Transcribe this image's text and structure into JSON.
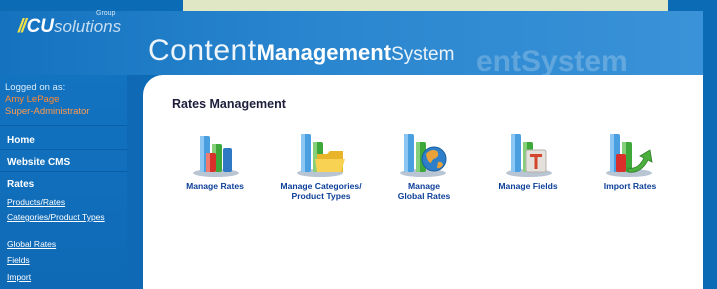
{
  "brand": {
    "logo_prefix": "//",
    "logo_bold": "CU",
    "logo_regular": "solutions",
    "logo_group": "Group",
    "title_part1": "Content",
    "title_part2": "Management",
    "title_part3": "System",
    "title_ghost": "entSystem"
  },
  "sidebar": {
    "logged_label": "Logged on as:",
    "user_name": "Amy LePage",
    "user_role": "Super-Administrator",
    "main_items": [
      {
        "label": "Home"
      },
      {
        "label": "Website CMS"
      },
      {
        "label": "Rates"
      }
    ],
    "sub_items": [
      {
        "label": "Products/Rates"
      },
      {
        "label": "Categories/Product Types"
      },
      {
        "label": "Global Rates"
      },
      {
        "label": "Fields"
      },
      {
        "label": "Import"
      }
    ]
  },
  "main": {
    "title": "Rates Management",
    "tiles": [
      {
        "label_line1": "Manage Rates",
        "label_line2": "",
        "icon": "rates-chart-icon"
      },
      {
        "label_line1": "Manage Categories/",
        "label_line2": "Product Types",
        "icon": "folder-chart-icon"
      },
      {
        "label_line1": "Manage",
        "label_line2": "Global Rates",
        "icon": "globe-chart-icon"
      },
      {
        "label_line1": "Manage Fields",
        "label_line2": "",
        "icon": "text-field-chart-icon"
      },
      {
        "label_line1": "Import Rates",
        "label_line2": "",
        "icon": "import-arrow-chart-icon"
      }
    ]
  },
  "colors": {
    "frame_blue": "#0b6bb5",
    "accent_orange": "#ff8a33",
    "link_blue": "#0c3f99",
    "top_strip": "#dfe7c4"
  }
}
